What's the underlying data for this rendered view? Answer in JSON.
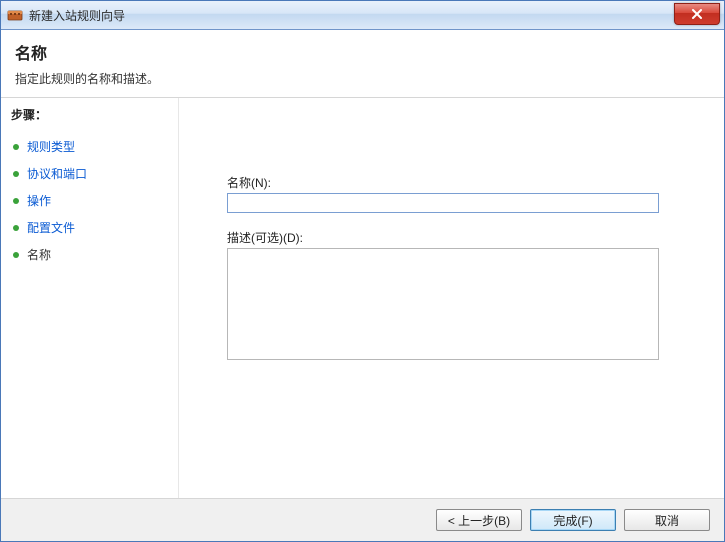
{
  "window": {
    "title": "新建入站规则向导"
  },
  "header": {
    "title": "名称",
    "subtitle": "指定此规则的名称和描述。"
  },
  "sidebar": {
    "steps_title": "步骤：",
    "items": [
      {
        "label": "规则类型",
        "current": false
      },
      {
        "label": "协议和端口",
        "current": false
      },
      {
        "label": "操作",
        "current": false
      },
      {
        "label": "配置文件",
        "current": false
      },
      {
        "label": "名称",
        "current": true
      }
    ]
  },
  "form": {
    "name_label": "名称(N):",
    "name_value": "",
    "desc_label": "描述(可选)(D):",
    "desc_value": ""
  },
  "footer": {
    "back": "< 上一步(B)",
    "finish": "完成(F)",
    "cancel": "取消"
  }
}
